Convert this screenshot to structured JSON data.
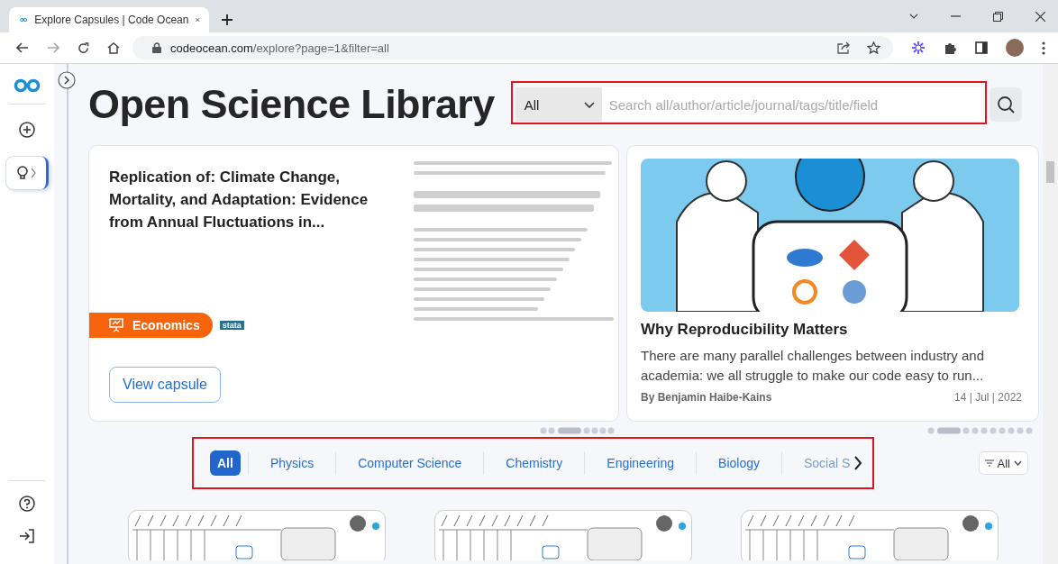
{
  "browser": {
    "tab_title": "Explore Capsules | Code Ocean",
    "url_host": "codeocean.com",
    "url_path": "/explore?page=1&filter=all"
  },
  "sidebar": {
    "items": [
      {
        "kind": "new",
        "selected": false
      },
      {
        "kind": "explore",
        "selected": true
      }
    ]
  },
  "page_title": "Open Science Library",
  "search": {
    "scope": "All",
    "placeholder": "Search all/author/article/journal/tags/title/field"
  },
  "capsule_card": {
    "title": "Replication of: Climate Change, Mortality, and Adaptation: Evidence from Annual Fluctuations in...",
    "tag": "Economics",
    "language": "stata",
    "button": "View capsule"
  },
  "article_card": {
    "title": "Why Reproducibility Matters",
    "excerpt": "There are many parallel challenges between industry and academia: we all struggle to make our code easy to run...",
    "author": "By Benjamin Haibe-Kains",
    "date": "14 | Jul | 2022"
  },
  "categories": [
    {
      "label": "All",
      "selected": true
    },
    {
      "label": "Physics",
      "selected": false
    },
    {
      "label": "Computer Science",
      "selected": false
    },
    {
      "label": "Chemistry",
      "selected": false
    },
    {
      "label": "Engineering",
      "selected": false
    },
    {
      "label": "Biology",
      "selected": false
    },
    {
      "label": "Social S",
      "selected": false
    }
  ],
  "filter": {
    "label": "All"
  }
}
